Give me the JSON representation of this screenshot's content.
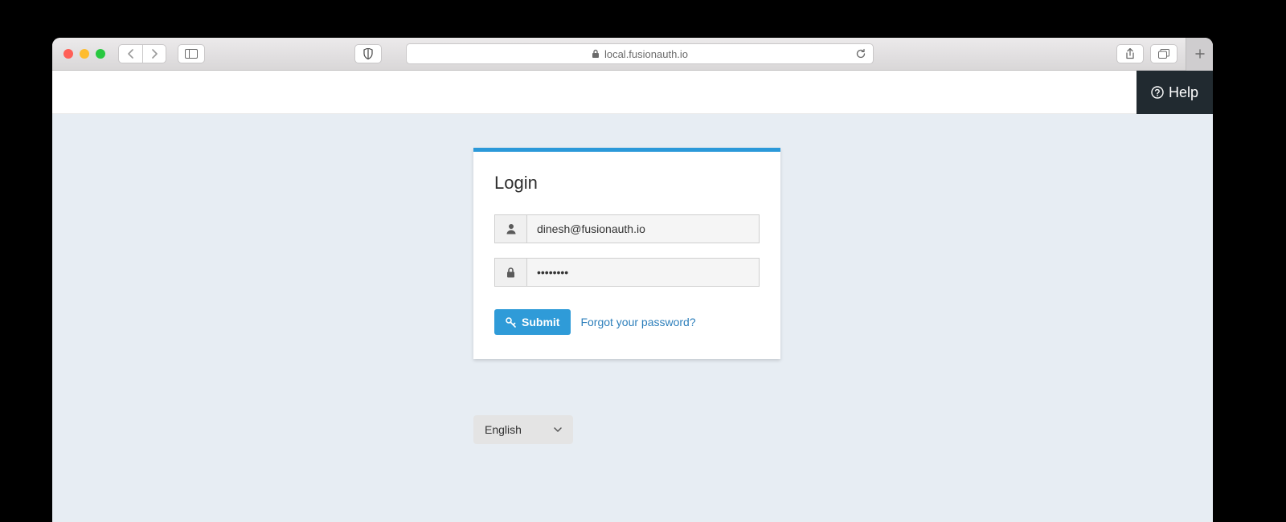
{
  "browser": {
    "url_display": "local.fusionauth.io"
  },
  "header": {
    "help_label": "Help"
  },
  "login": {
    "title": "Login",
    "email_value": "dinesh@fusionauth.io",
    "password_value": "••••••••",
    "submit_label": "Submit",
    "forgot_link_label": "Forgot your password?"
  },
  "language": {
    "selected": "English"
  }
}
